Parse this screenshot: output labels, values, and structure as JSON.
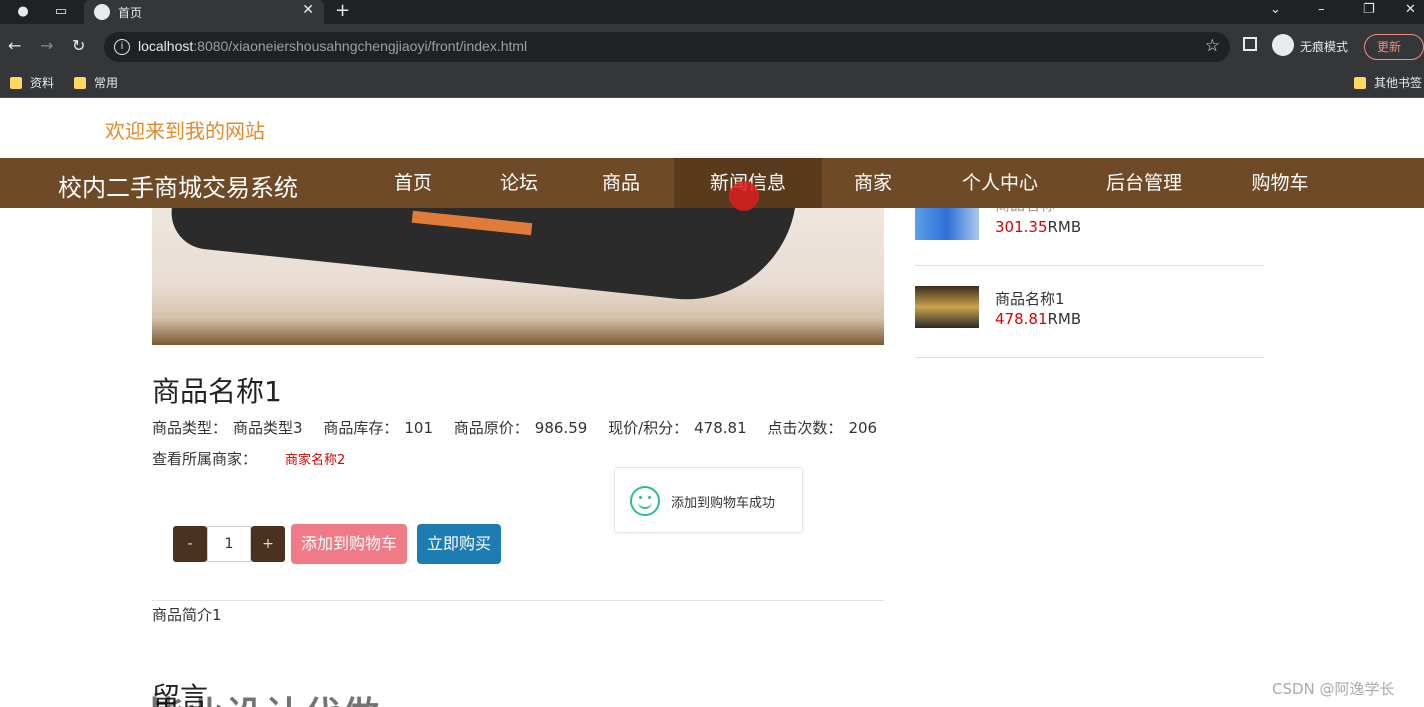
{
  "browser": {
    "tab_title": "首页",
    "url_host": "localhost",
    "url_rest": ":8080/xiaoneiershousahngchengjiaoyi/front/index.html",
    "incognito_label": "无痕模式",
    "update_label": "更新",
    "bookmarks": [
      "资料",
      "常用"
    ],
    "other_bookmarks": "其他书签"
  },
  "site": {
    "welcome": "欢迎来到我的网站",
    "brand": "校内二手商城交易系统",
    "nav": [
      "首页",
      "论坛",
      "商品",
      "新闻信息",
      "商家",
      "个人中心",
      "后台管理",
      "购物车"
    ]
  },
  "sidebar": {
    "items": [
      {
        "name": "商品名称",
        "price": "301.35",
        "unit": "RMB"
      },
      {
        "name": "商品名称1",
        "price": "478.81",
        "unit": "RMB"
      }
    ]
  },
  "product": {
    "title": "商品名称1",
    "type_label": "商品类型：",
    "type_value": "商品类型3",
    "stock_label": "商品库存：",
    "stock_value": "101",
    "orig_label": "商品原价：",
    "orig_value": "986.59",
    "price_label": "现价/积分：",
    "price_value": "478.81",
    "clicks_label": "点击次数：",
    "clicks_value": "206",
    "seller_label": "查看所属商家：",
    "seller_name": "商家名称2",
    "qty": "1",
    "minus": "-",
    "plus": "+",
    "add_cart": "添加到购物车",
    "buy_now": "立即购买",
    "intro": "商品简介1"
  },
  "toast": {
    "message": "添加到购物车成功"
  },
  "comments": {
    "title": "留言"
  },
  "overlay": {
    "big_text": "毕业设计代做",
    "csdn": "CSDN @阿逸学长"
  },
  "colors": {
    "nav_bg": "#6f4a27",
    "welcome": "#e28a2c",
    "price": "#dd0000",
    "cart_btn": "#f07b86",
    "buy_btn": "#1d7db2"
  }
}
